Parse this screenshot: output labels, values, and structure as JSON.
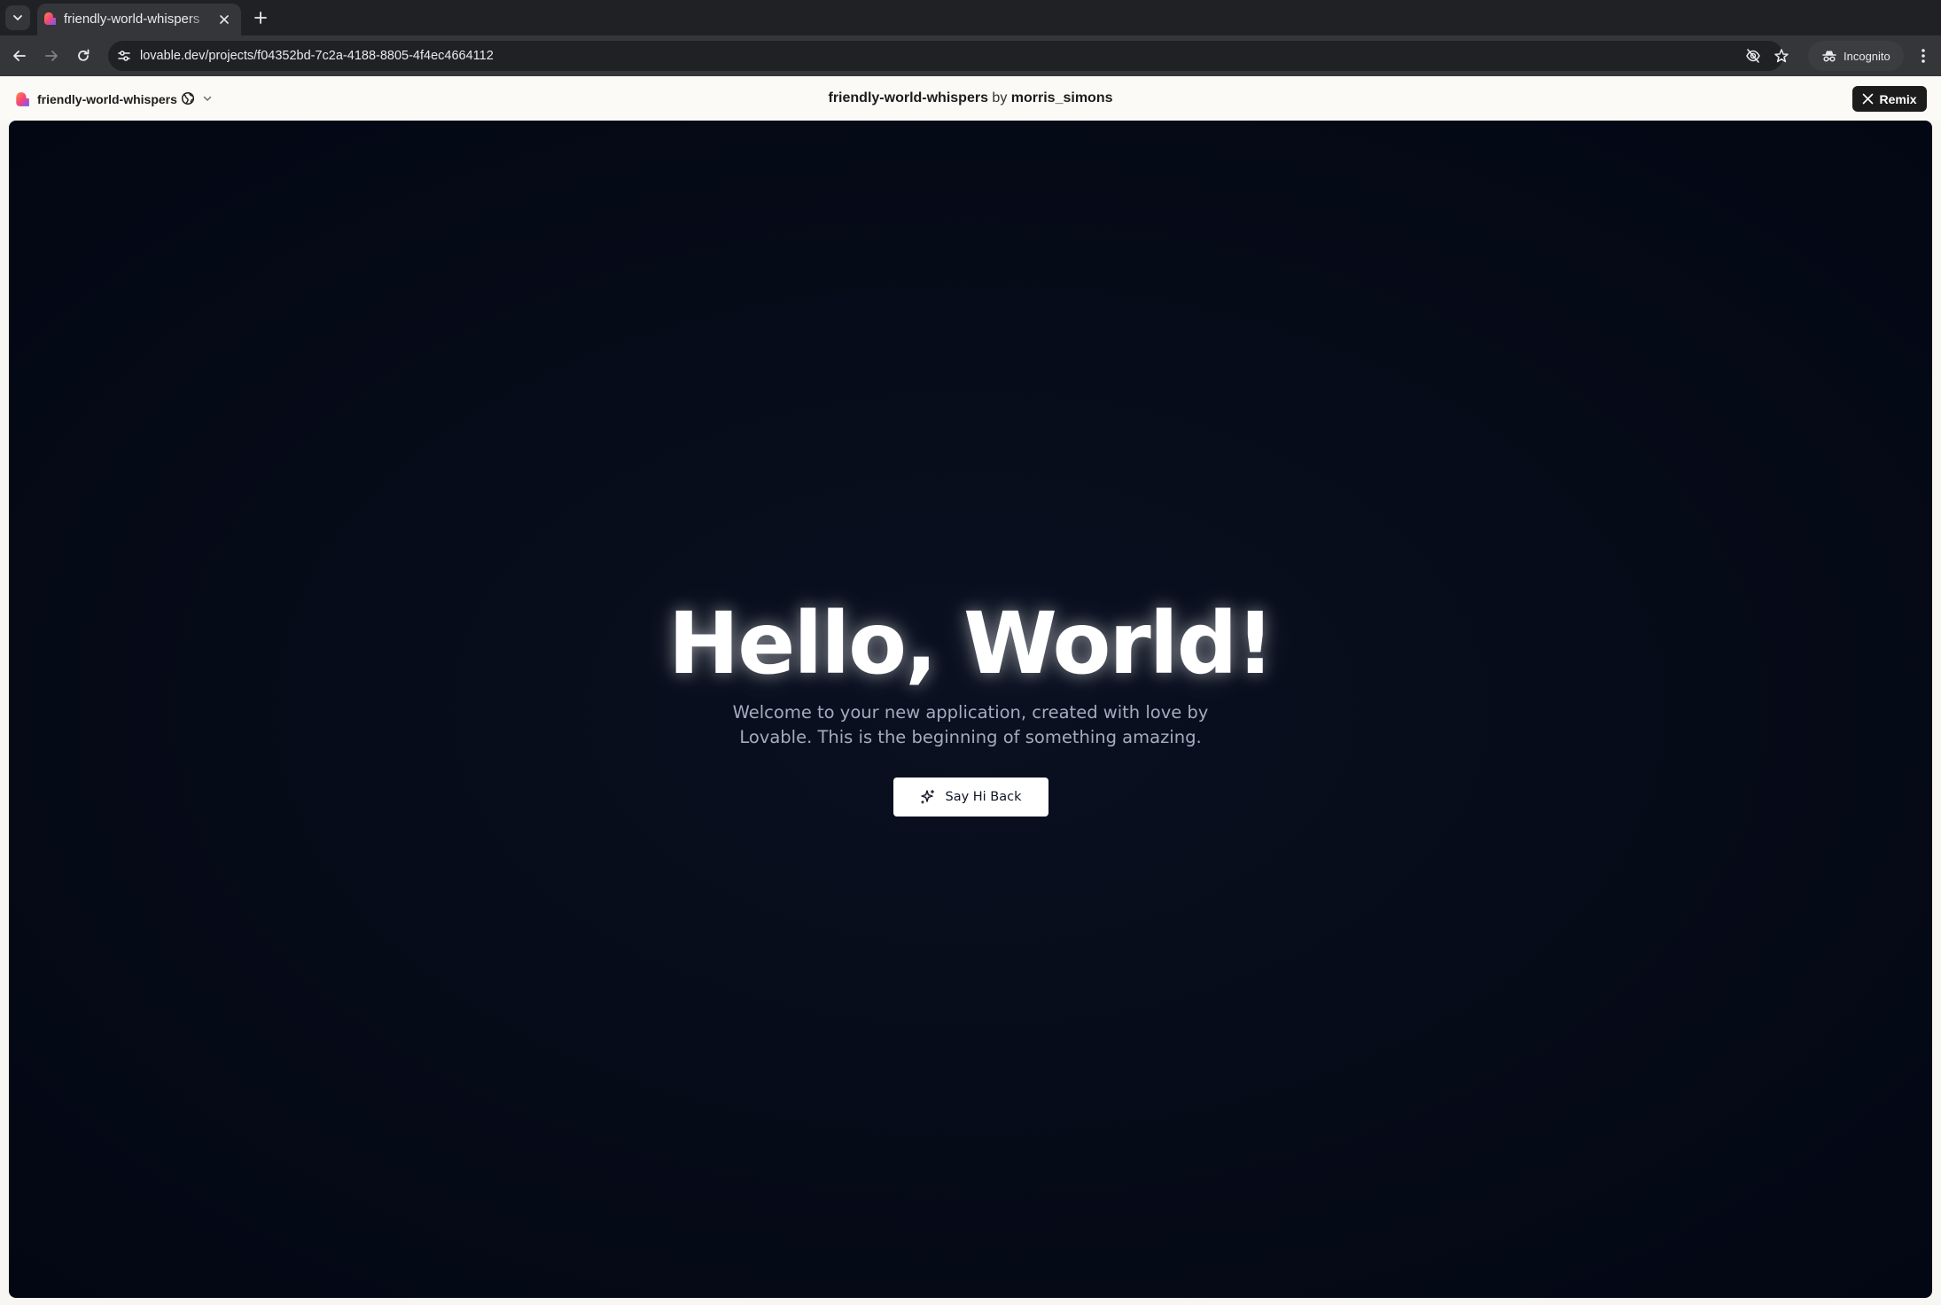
{
  "browser": {
    "tab": {
      "title": "friendly-world-whispers",
      "close_icon": "close-icon"
    },
    "new_tab_icon": "plus-icon",
    "tab_list_icon": "chevron-down-icon",
    "nav": {
      "back_icon": "arrow-left-icon",
      "forward_icon": "arrow-right-icon",
      "reload_icon": "reload-icon"
    },
    "omnibox": {
      "url": "lovable.dev/projects/f04352bd-7c2a-4188-8805-4f4ec4664112",
      "site_info_icon": "tune-icon",
      "eye_off_icon": "eye-off-icon",
      "bookmark_icon": "star-icon"
    },
    "incognito_label": "Incognito",
    "menu_icon": "kebab-menu-icon"
  },
  "project_bar": {
    "project_name": "friendly-world-whispers",
    "title_project": "friendly-world-whispers",
    "title_by": "by",
    "title_author": "morris_simons",
    "remix_label": "Remix"
  },
  "preview": {
    "heading": "Hello, World!",
    "subtitle": "Welcome to your new application, created with love by Lovable. This is the beginning of something amazing.",
    "button_label": "Say Hi Back",
    "button_icon": "sparkles-icon"
  },
  "colors": {
    "chrome_dark": "#202124",
    "chrome_toolbar": "#35363a",
    "preview_bg": "#060b18",
    "remix_bg": "#1c1c1c",
    "subtitle": "#a3acbd"
  }
}
